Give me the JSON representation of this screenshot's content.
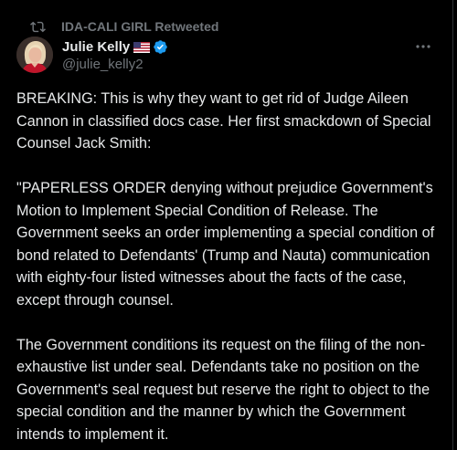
{
  "retweet": {
    "icon": "retweet-icon",
    "label": "IDA-CALI GIRL Retweeted"
  },
  "author": {
    "display_name": "Julie Kelly",
    "handle": "@julie_kelly2",
    "flag_icon": "us-flag-icon",
    "verified_icon": "verified-badge-icon",
    "verified_color": "#1d9bf0"
  },
  "more_icon": "more-options-icon",
  "tweet": {
    "paragraphs": [
      "BREAKING: This is why they want to get rid of Judge Aileen Cannon in classified docs case. Her first smackdown of Special Counsel Jack Smith:",
      "\"PAPERLESS ORDER denying without prejudice Government's Motion to Implement Special Condition of Release. The Government seeks an order implementing a special condition of bond related to Defendants' (Trump and Nauta) communication with eighty-four listed witnesses about the facts of the case, except through counsel.",
      "The Government conditions its request on the filing of the non-exhaustive list under seal. Defendants take no position on the Government's seal request but reserve the right to object to the special condition and the manner by which the Government intends to implement it."
    ]
  },
  "colors": {
    "background": "#000000",
    "text": "#e7e9ea",
    "secondary": "#71767b"
  }
}
